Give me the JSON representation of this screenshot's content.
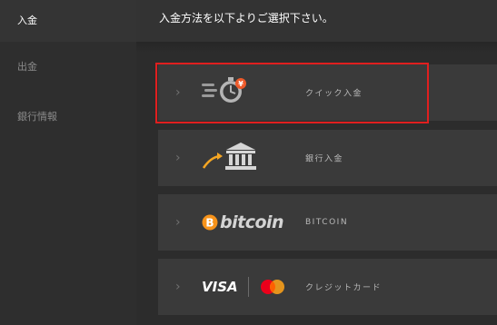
{
  "sidebar": {
    "items": [
      {
        "label": "入金",
        "active": true
      },
      {
        "label": "出金",
        "active": false
      },
      {
        "label": "銀行情報",
        "active": false
      }
    ]
  },
  "header": {
    "title": "入金方法を以下よりご選択下さい。"
  },
  "methods": [
    {
      "label": "クイック入金",
      "icon": "quick-deposit-stopwatch-icon",
      "selected": true
    },
    {
      "label": "銀行入金",
      "icon": "bank-icon",
      "selected": false
    },
    {
      "label": "BITCOIN",
      "icon": "bitcoin-logo",
      "logo_text": "bitcoin",
      "selected": false
    },
    {
      "label": "クレジットカード",
      "icon": "visa-mastercard-icon",
      "logo_text": "VISA",
      "selected": false
    }
  ],
  "colors": {
    "selection_outline": "#e01f1f",
    "accent_orange": "#f7931a",
    "bank_arrow": "#f5a623",
    "mastercard_red": "#eb001b",
    "mastercard_orange": "#f79e1b"
  }
}
